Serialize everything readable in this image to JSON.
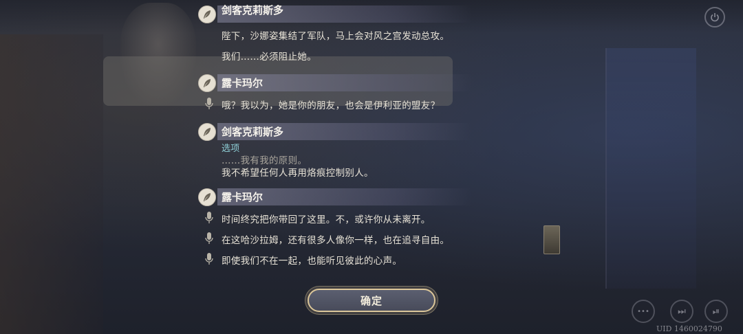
{
  "entries": [
    {
      "speaker": "剑客克莉斯多",
      "lines": [
        {
          "text": "陛下，沙娜姿集结了军队，马上会对风之宫发动总攻。"
        },
        {
          "text": "我们……必须阻止她。"
        }
      ]
    },
    {
      "speaker": "露卡玛尔",
      "lines": [
        {
          "text": "哦？我以为，她是你的朋友，也会是伊利亚的盟友？",
          "voiced": true
        }
      ]
    },
    {
      "speaker": "剑客克莉斯多",
      "option_label": "选项",
      "lines": [
        {
          "text": "……我有我的原则。",
          "dim": true
        },
        {
          "text": "我不希望任何人再用烙痕控制别人。"
        }
      ]
    },
    {
      "speaker": "露卡玛尔",
      "lines": [
        {
          "text": "时间终究把你带回了这里。不，或许你从未离开。",
          "voiced": true
        },
        {
          "text": "在这哈沙拉姆，还有很多人像你一样，也在追寻自由。",
          "voiced": true
        },
        {
          "text": "即使我们不在一起，也能听见彼此的心声。",
          "voiced": true
        }
      ]
    }
  ],
  "confirm_button": {
    "label": "确定"
  },
  "controls": {
    "more_label": "•••",
    "skip_label": "⏭",
    "play_label": "⏯"
  },
  "uid": "UID 1460024790",
  "icons": {
    "speaker": "feather-icon",
    "voice": "microphone-icon",
    "top_right": "power-icon"
  },
  "colors": {
    "gold_border": "#dcc79a",
    "option_text": "#8fd0d8"
  }
}
